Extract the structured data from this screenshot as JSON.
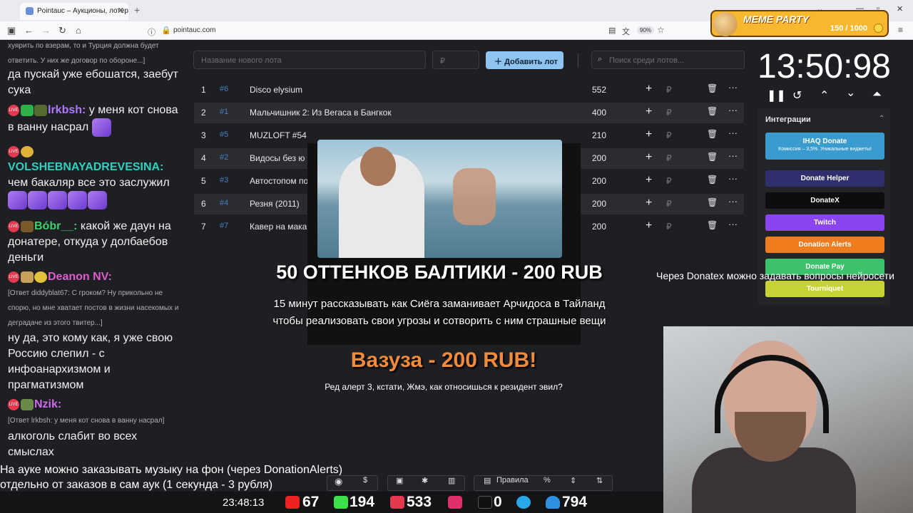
{
  "browser": {
    "tab_title": "Pointauc – Аукционы, лотереи",
    "tab_close": "✕",
    "new_tab": "+",
    "url": "pointauc.com",
    "zoom": "90%"
  },
  "meme_party": {
    "title": "MEME PARTY",
    "count": "150 / 1000"
  },
  "chat": {
    "messages": [
      {
        "text": "хуярить по взерам, то и Турция должна будет ответить. У них же договор по обороне...]"
      },
      {
        "text": "да пускай уже ебошатся, заебут сука"
      },
      {
        "nick": "lrkbsh:",
        "text": "у меня кот снова в ванну насрал"
      },
      {
        "nick": "VOLSHEBNAYADREVESINA:",
        "text": "чем бакаляр все это заслужил"
      },
      {
        "nick": "Bóbr__:",
        "text": "какой же даун на донатере, откуда у долбаебов деньги"
      },
      {
        "nick": "Deanon NV:",
        "reply": "[Ответ diddyblat67: С гроком? Ну прикольно не спорю, но мне хватает постов в жизни насекомых и деградаче из этого твитер...]",
        "text": "ну да, это кому как, я уже свою Россию слепил - с инфоанархизмом и прагматизмом"
      },
      {
        "nick": "Nzik:",
        "reply": "[Ответ lrkbsh: у меня кот снова в ванну насрал]",
        "text": "алкоголь слабит во всех смыслах"
      }
    ],
    "live_badge": "LIVE"
  },
  "auction": {
    "new_lot_placeholder": "Название нового лота",
    "amount_placeholder": "₽",
    "add_button": "Добавить лот",
    "search_placeholder": "Поиск среди лотов...",
    "lots": [
      {
        "n": "1",
        "id": "#6",
        "name": "Disco elysium",
        "amount": "552"
      },
      {
        "n": "2",
        "id": "#1",
        "name": "Мальчишник 2: Из Вегаса в Бангкок",
        "amount": "400"
      },
      {
        "n": "3",
        "id": "#5",
        "name": "MUZLOFT #54",
        "amount": "210"
      },
      {
        "n": "4",
        "id": "#2",
        "name": "Видосы без ю",
        "amount": "200"
      },
      {
        "n": "5",
        "id": "#3",
        "name": "Автостопом по",
        "amount": "200"
      },
      {
        "n": "6",
        "id": "#4",
        "name": "Резня (2011)",
        "amount": "200"
      },
      {
        "n": "7",
        "id": "#7",
        "name": "Кавер на мака",
        "amount": "200"
      }
    ],
    "row_plus": "+",
    "row_currency": "₽",
    "row_more": "···"
  },
  "alert": {
    "title": "50 ОТТЕНКОВ БАЛТИКИ - 200 RUB",
    "text": "15 минут рассказывать как Сиёга заманивает Арчидоса в Тайланд чтобы реализовать свои угрозы и сотворить с ним страшные вещи",
    "title2": "Вазуза - 200 RUB!",
    "text2": "Ред алерт 3, кстати, Жмэ, как относишься к резидент эвил?"
  },
  "timer": {
    "value": "13:50:98"
  },
  "integrations": {
    "header": "Интеграции",
    "buttons": [
      {
        "label": "IHAQ Donate",
        "sub": "Комиссия – 3,5%. Уникальные виджеты!",
        "color": "#3a9bcf"
      },
      {
        "label": "Donate Helper",
        "color": "#2f2f6e"
      },
      {
        "label": "DonateX",
        "color": "#0d0d10"
      },
      {
        "label": "Twitch",
        "color": "#8a45f0"
      },
      {
        "label": "Donation Alerts",
        "color": "#f07c1d"
      },
      {
        "label": "Donate Pay",
        "color": "#3bc26a"
      },
      {
        "label": "Tourniquet",
        "color": "#c7d334"
      }
    ]
  },
  "overlay_note": "Через Donatex можно задавать вопросы нейросети",
  "ticker": {
    "line1": "На ауке можно заказывать музыку на фон (через DonationAlerts)",
    "line2": "отдельно от заказов в сам аук (1 секунда - 3 рубля)"
  },
  "toolbar": {
    "rules": "Правила",
    "percent": "%"
  },
  "status": {
    "clock": "23:48:13",
    "youtube": "67",
    "kick": "194",
    "vk": "533",
    "other": "0",
    "telegram": "794"
  }
}
